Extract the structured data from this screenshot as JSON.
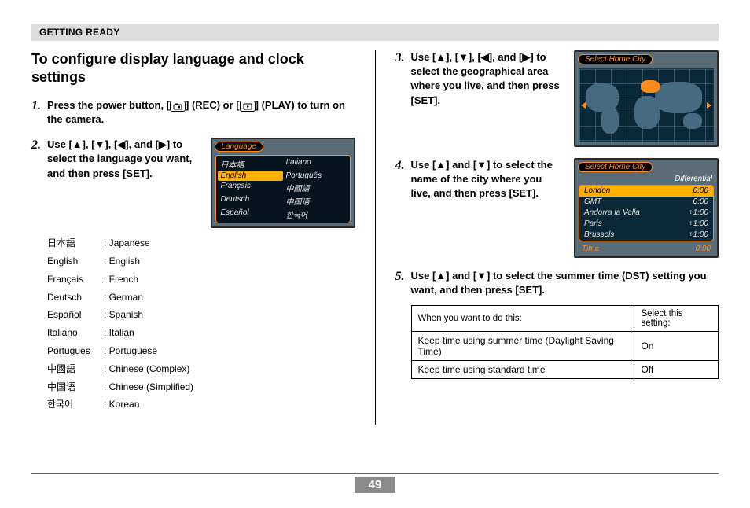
{
  "header": "GETTING READY",
  "title": "To configure display language and clock settings",
  "page_number": "49",
  "icons": {
    "rec": "●",
    "play": "▶"
  },
  "steps": {
    "s1": {
      "num": "1.",
      "text_a": "Press the power button, [",
      "text_b": "] (REC) or [",
      "text_c": "] (PLAY) to turn on the camera."
    },
    "s2": {
      "num": "2.",
      "text": "Use [▲], [▼], [◀], and [▶] to select the language you want, and then press [SET]."
    },
    "s3": {
      "num": "3.",
      "text": "Use [▲], [▼], [◀], and [▶] to select the geographical area where you live, and then press [SET]."
    },
    "s4": {
      "num": "4.",
      "text": "Use [▲] and [▼] to select the name of the city where you live, and then press [SET]."
    },
    "s5": {
      "num": "5.",
      "text": "Use [▲] and [▼] to select the summer time (DST) setting you want, and then press [SET]."
    }
  },
  "languages": [
    {
      "native": "日本語",
      "en": "Japanese"
    },
    {
      "native": "English",
      "en": "English"
    },
    {
      "native": "Français",
      "en": "French"
    },
    {
      "native": "Deutsch",
      "en": "German"
    },
    {
      "native": "Español",
      "en": "Spanish"
    },
    {
      "native": "Italiano",
      "en": "Italian"
    },
    {
      "native": "Português",
      "en": "Portuguese"
    },
    {
      "native": "中國語",
      "en": "Chinese (Complex)"
    },
    {
      "native": "中国语",
      "en": "Chinese (Simplified)"
    },
    {
      "native": "한국어",
      "en": "Korean"
    }
  ],
  "lcd_language": {
    "title": "Language",
    "grid": [
      [
        "日本語",
        "Italiano"
      ],
      [
        "English",
        "Português"
      ],
      [
        "Français",
        "中國語"
      ],
      [
        "Deutsch",
        "中国语"
      ],
      [
        "Español",
        "한국어"
      ]
    ],
    "selected": "English"
  },
  "lcd_map": {
    "title": "Select Home City"
  },
  "lcd_city": {
    "title": "Select Home City",
    "differential_label": "Differential",
    "rows": [
      {
        "name": "London",
        "offset": "0:00",
        "selected": true
      },
      {
        "name": "GMT",
        "offset": "0:00"
      },
      {
        "name": "Andorra la Vella",
        "offset": "+1:00"
      },
      {
        "name": "Paris",
        "offset": "+1:00"
      },
      {
        "name": "Brussels",
        "offset": "+1:00"
      }
    ],
    "footer_label": "Time",
    "footer_value": "0:00"
  },
  "dst_table": {
    "head_when": "When you want to do this:",
    "head_select": "Select this setting:",
    "rows": [
      {
        "when": "Keep time using summer time (Daylight Saving Time)",
        "select": "On"
      },
      {
        "when": "Keep time using standard time",
        "select": "Off"
      }
    ]
  }
}
